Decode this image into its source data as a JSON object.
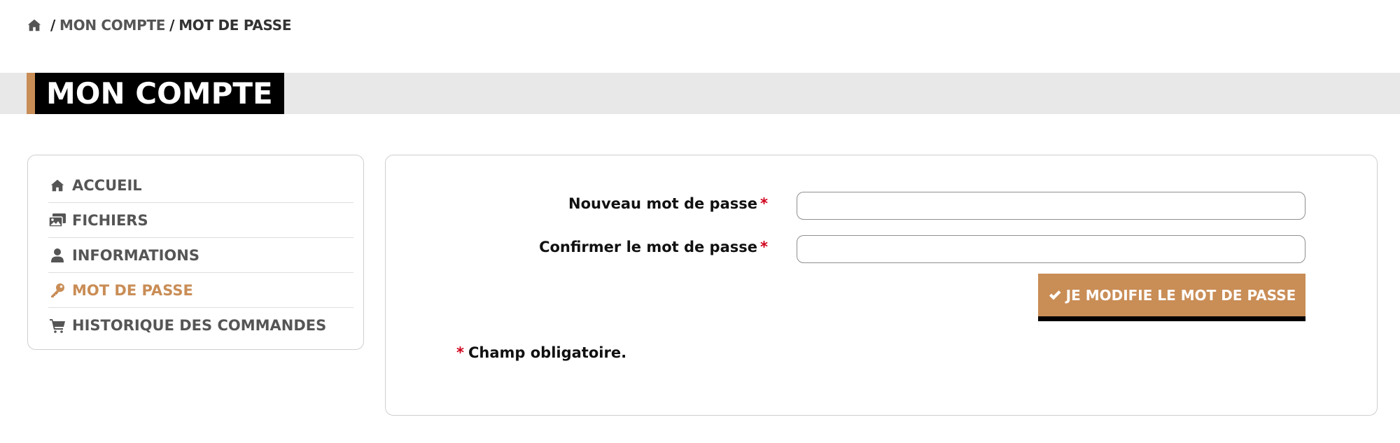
{
  "breadcrumb": {
    "home_icon": "home-icon",
    "separator": "/",
    "items": [
      "MON COMPTE",
      "MOT DE PASSE"
    ]
  },
  "page_title": "MON COMPTE",
  "colors": {
    "accent": "#c98d56",
    "title_bg": "#000000",
    "band_bg": "#e8e8e8",
    "required": "#d0021b"
  },
  "sidebar": {
    "items": [
      {
        "label": "ACCUEIL",
        "icon": "home-icon",
        "active": false
      },
      {
        "label": "FICHIERS",
        "icon": "images-icon",
        "active": false
      },
      {
        "label": "INFORMATIONS",
        "icon": "user-icon",
        "active": false
      },
      {
        "label": "MOT DE PASSE",
        "icon": "key-icon",
        "active": true
      },
      {
        "label": "HISTORIQUE DES COMMANDES",
        "icon": "cart-icon",
        "active": false
      }
    ]
  },
  "form": {
    "new_password_label": "Nouveau mot de passe",
    "new_password_value": "",
    "confirm_password_label": "Confirmer le mot de passe",
    "confirm_password_value": "",
    "required_mark": "*",
    "submit_icon": "check-icon",
    "submit_label": "JE MODIFIE LE MOT DE PASSE",
    "required_note": "Champ obligatoire."
  }
}
